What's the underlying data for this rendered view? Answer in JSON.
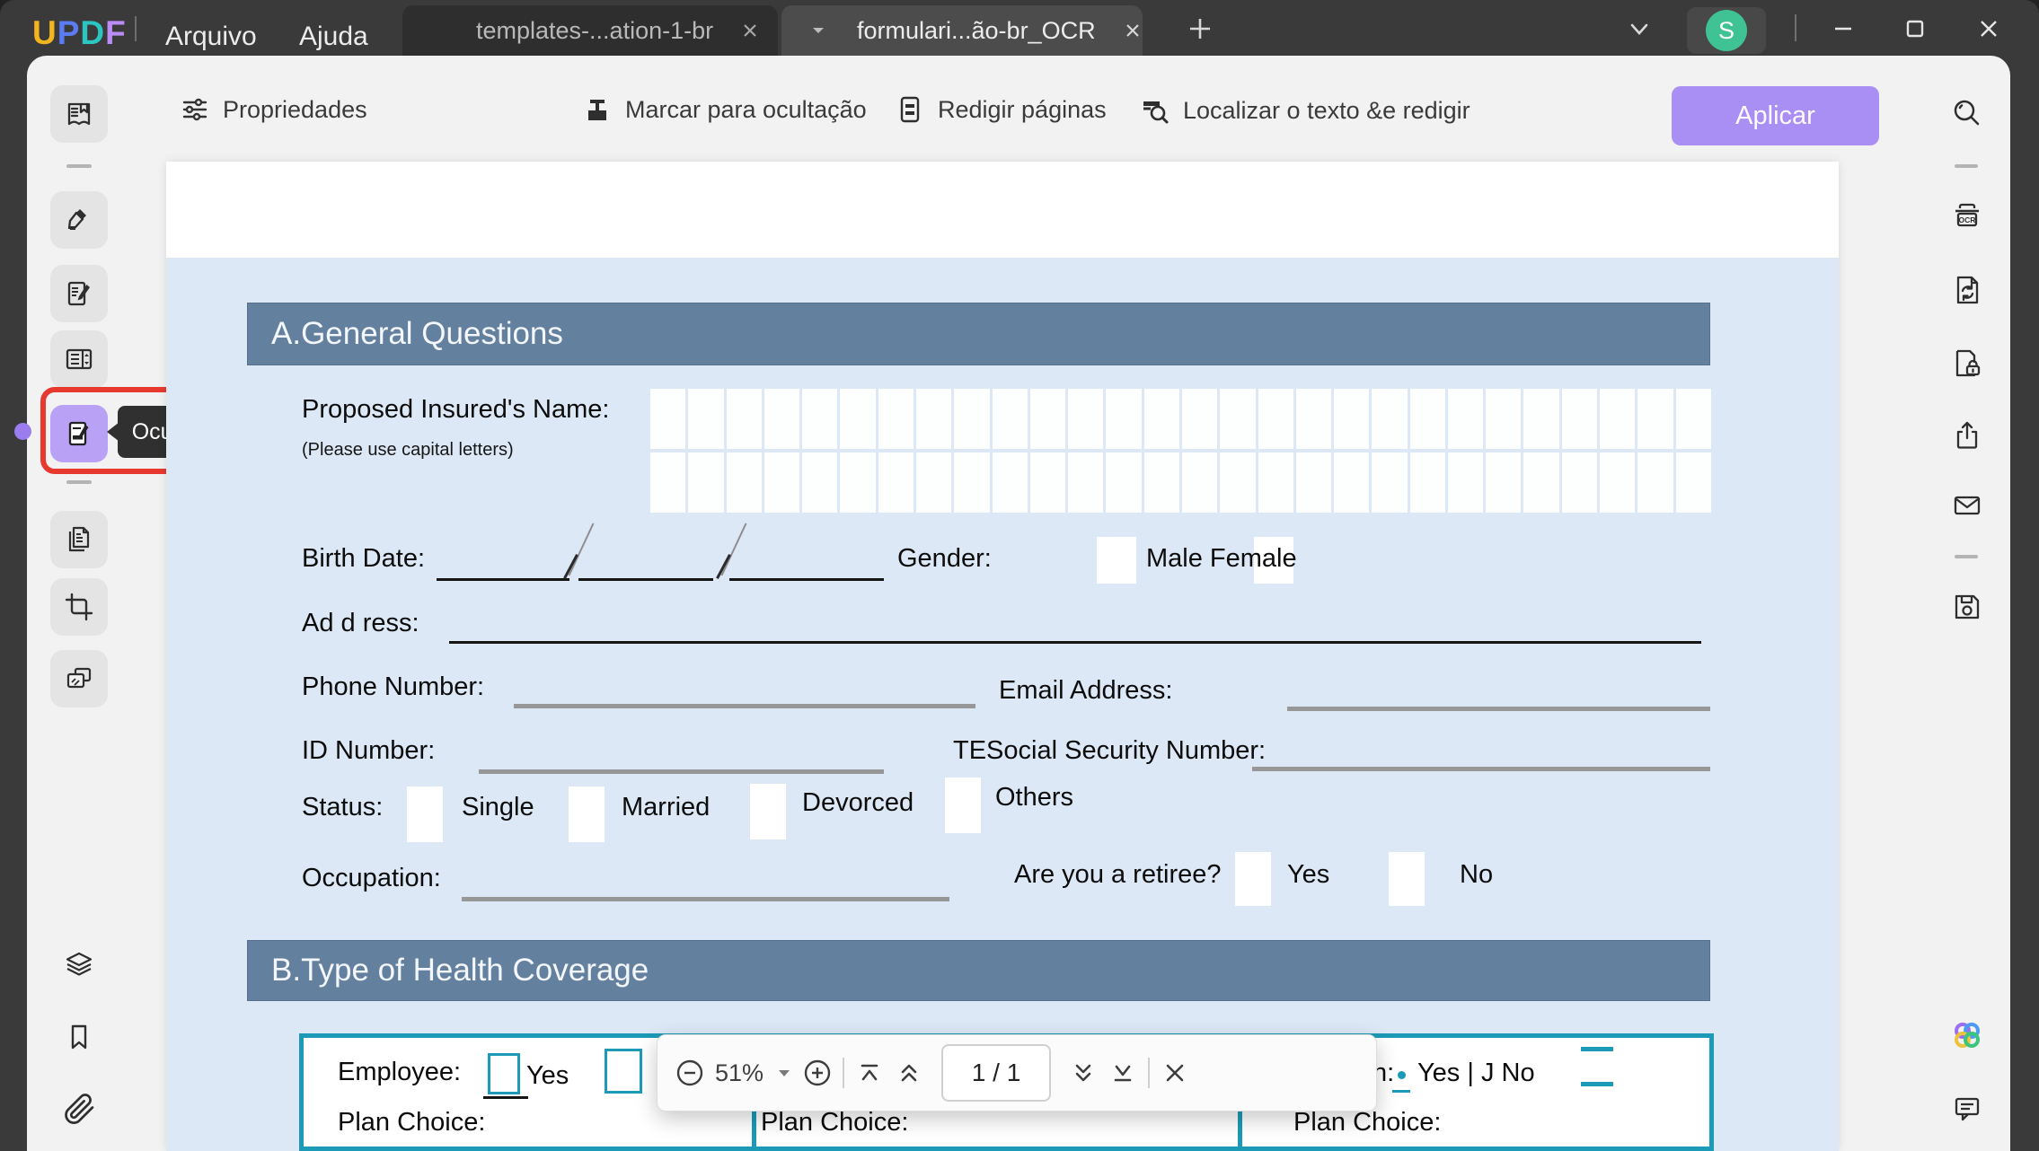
{
  "brand_colors": {
    "accent_purple": "#a98ef3",
    "highlight_purple": "#b9a1f6",
    "alert_red": "#e8392f",
    "teal_border": "#1c9ab7",
    "avatar_green": "#3fc394",
    "section_slate": "#64809f",
    "form_blue": "#dce8f6"
  },
  "titlebar": {
    "logo_letters": [
      {
        "ch": "U",
        "color": "#f2b520"
      },
      {
        "ch": "P",
        "color": "#5b7bf2"
      },
      {
        "ch": "D",
        "color": "#2dc5c0"
      },
      {
        "ch": "F",
        "color": "#bb8cf6"
      }
    ],
    "menus": [
      {
        "label": "Arquivo"
      },
      {
        "label": "Ajuda"
      }
    ],
    "tabs": [
      {
        "label": "templates-...ation-1-br",
        "active": false
      },
      {
        "label": "formulari...ão-br_OCR",
        "active": true
      }
    ],
    "new_tab": "+",
    "avatar": "S"
  },
  "toolbar": {
    "properties": "Propriedades",
    "mark_redaction": "Marcar para ocultação",
    "redact_pages": "Redigir páginas",
    "find_redact": "Localizar o texto &e redigir",
    "apply": "Aplicar"
  },
  "tooltip": {
    "label": "Ocultar"
  },
  "sidebar_icons": {
    "left": [
      "reader-icon",
      "highlighter-icon",
      "edit-icon",
      "organize-icon",
      "redact-icon",
      "pages-icon",
      "crop-icon",
      "watermark-icon",
      "layers-icon",
      "bookmark-icon",
      "attachment-icon"
    ],
    "right": [
      "search-icon",
      "ocr-icon",
      "convert-icon",
      "protect-icon",
      "share-icon",
      "mail-icon",
      "save-icon",
      "ai-icon",
      "comment-icon"
    ]
  },
  "form": {
    "section_a": "A.General Questions",
    "name_label": "Proposed Insured's Name:",
    "name_hint": "(Please use capital letters)",
    "name_cells_per_row": 28,
    "birth_label": "Birth Date:",
    "gender_label": "Gender:",
    "gender_options": "Male Female",
    "address_label": "Ad d ress:",
    "phone_label": "Phone Number:",
    "email_label": "Email Address:",
    "id_label": "ID Number:",
    "ssn_label": "TESocial Security Number:",
    "status_label": "Status:",
    "status_options": [
      "Single",
      "Married",
      "Devorced",
      "Others"
    ],
    "occupation_label": "Occupation:",
    "retiree_label": "Are you a retiree?",
    "yes": "Yes",
    "no": "No",
    "section_b": "B.Type of Health Coverage",
    "employee_label": "Employee:",
    "employee_yes": "Yes",
    "right_cell_fragment": "n:",
    "right_cell_text": "Yes | J No",
    "plan_choice": "Plan Choice:"
  },
  "pager": {
    "zoom_level": "51%",
    "page_indicator": "1 / 1"
  }
}
